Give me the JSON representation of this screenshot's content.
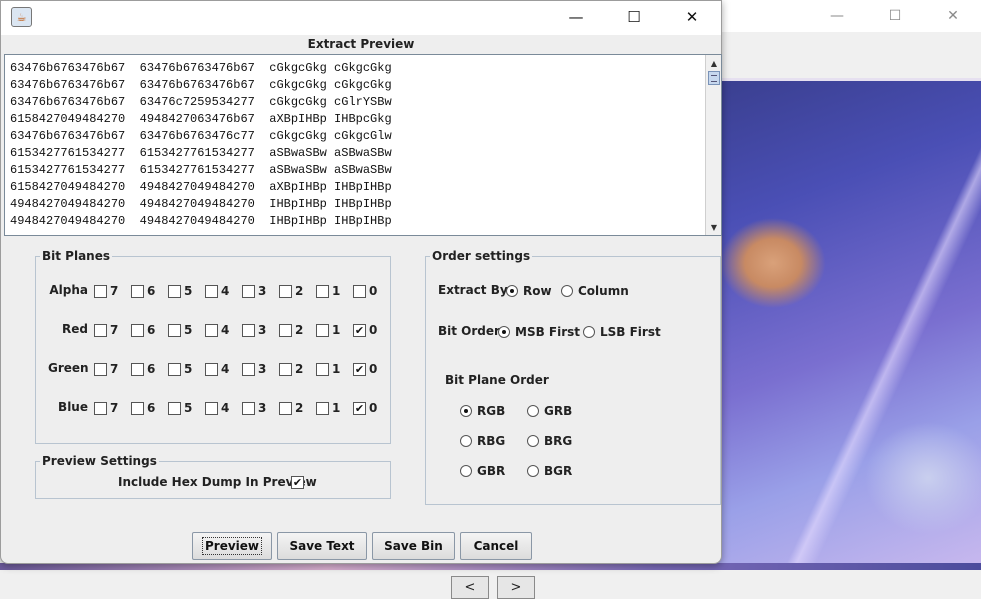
{
  "background_window": {
    "minimize_glyph": "—",
    "maximize_glyph": "☐",
    "close_glyph": "✕",
    "nav_prev": "<",
    "nav_next": ">"
  },
  "dialog": {
    "icon_glyph": "☕",
    "minimize_glyph": "—",
    "maximize_glyph": "☐",
    "close_glyph": "✕",
    "title": "Extract Preview"
  },
  "preview": {
    "lines": [
      "63476b6763476b67  63476b6763476b67  cGkgcGkg cGkgcGkg",
      "63476b6763476b67  63476b6763476b67  cGkgcGkg cGkgcGkg",
      "63476b6763476b67  63476c7259534277  cGkgcGkg cGlrYSBw",
      "6158427049484270  4948427063476b67  aXBpIHBp IHBpcGkg",
      "63476b6763476b67  63476b6763476c77  cGkgcGkg cGkgcGlw",
      "6153427761534277  6153427761534277  aSBwaSBw aSBwaSBw",
      "6153427761534277  6153427761534277  aSBwaSBw aSBwaSBw",
      "6158427049484270  4948427049484270  aXBpIHBp IHBpIHBp",
      "4948427049484270  4948427049484270  IHBpIHBp IHBpIHBp",
      "4948427049484270  4948427049484270  IHBpIHBp IHBpIHBp"
    ]
  },
  "bit_planes": {
    "title": "Bit Planes",
    "bits": [
      "7",
      "6",
      "5",
      "4",
      "3",
      "2",
      "1",
      "0"
    ],
    "rows": [
      {
        "label": "Alpha",
        "checked": [
          false,
          false,
          false,
          false,
          false,
          false,
          false,
          false
        ]
      },
      {
        "label": "Red",
        "checked": [
          false,
          false,
          false,
          false,
          false,
          false,
          false,
          true
        ]
      },
      {
        "label": "Green",
        "checked": [
          false,
          false,
          false,
          false,
          false,
          false,
          false,
          true
        ]
      },
      {
        "label": "Blue",
        "checked": [
          false,
          false,
          false,
          false,
          false,
          false,
          false,
          true
        ]
      }
    ]
  },
  "preview_settings": {
    "title": "Preview Settings",
    "hex_dump_label": "Include Hex Dump In Preview",
    "hex_dump_checked": true
  },
  "order_settings": {
    "title": "Order settings",
    "extract_by_label": "Extract By",
    "extract_by_options": [
      {
        "label": "Row",
        "selected": true
      },
      {
        "label": "Column",
        "selected": false
      }
    ],
    "bit_order_label": "Bit Order",
    "bit_order_options": [
      {
        "label": "MSB First",
        "selected": true
      },
      {
        "label": "LSB First",
        "selected": false
      }
    ],
    "plane_order_label": "Bit Plane Order",
    "plane_order_options": [
      {
        "label": "RGB",
        "selected": true
      },
      {
        "label": "GRB",
        "selected": false
      },
      {
        "label": "RBG",
        "selected": false
      },
      {
        "label": "BRG",
        "selected": false
      },
      {
        "label": "GBR",
        "selected": false
      },
      {
        "label": "BGR",
        "selected": false
      }
    ]
  },
  "buttons": {
    "preview": "Preview",
    "save_text": "Save Text",
    "save_bin": "Save Bin",
    "cancel": "Cancel"
  },
  "check_glyph": "✔"
}
